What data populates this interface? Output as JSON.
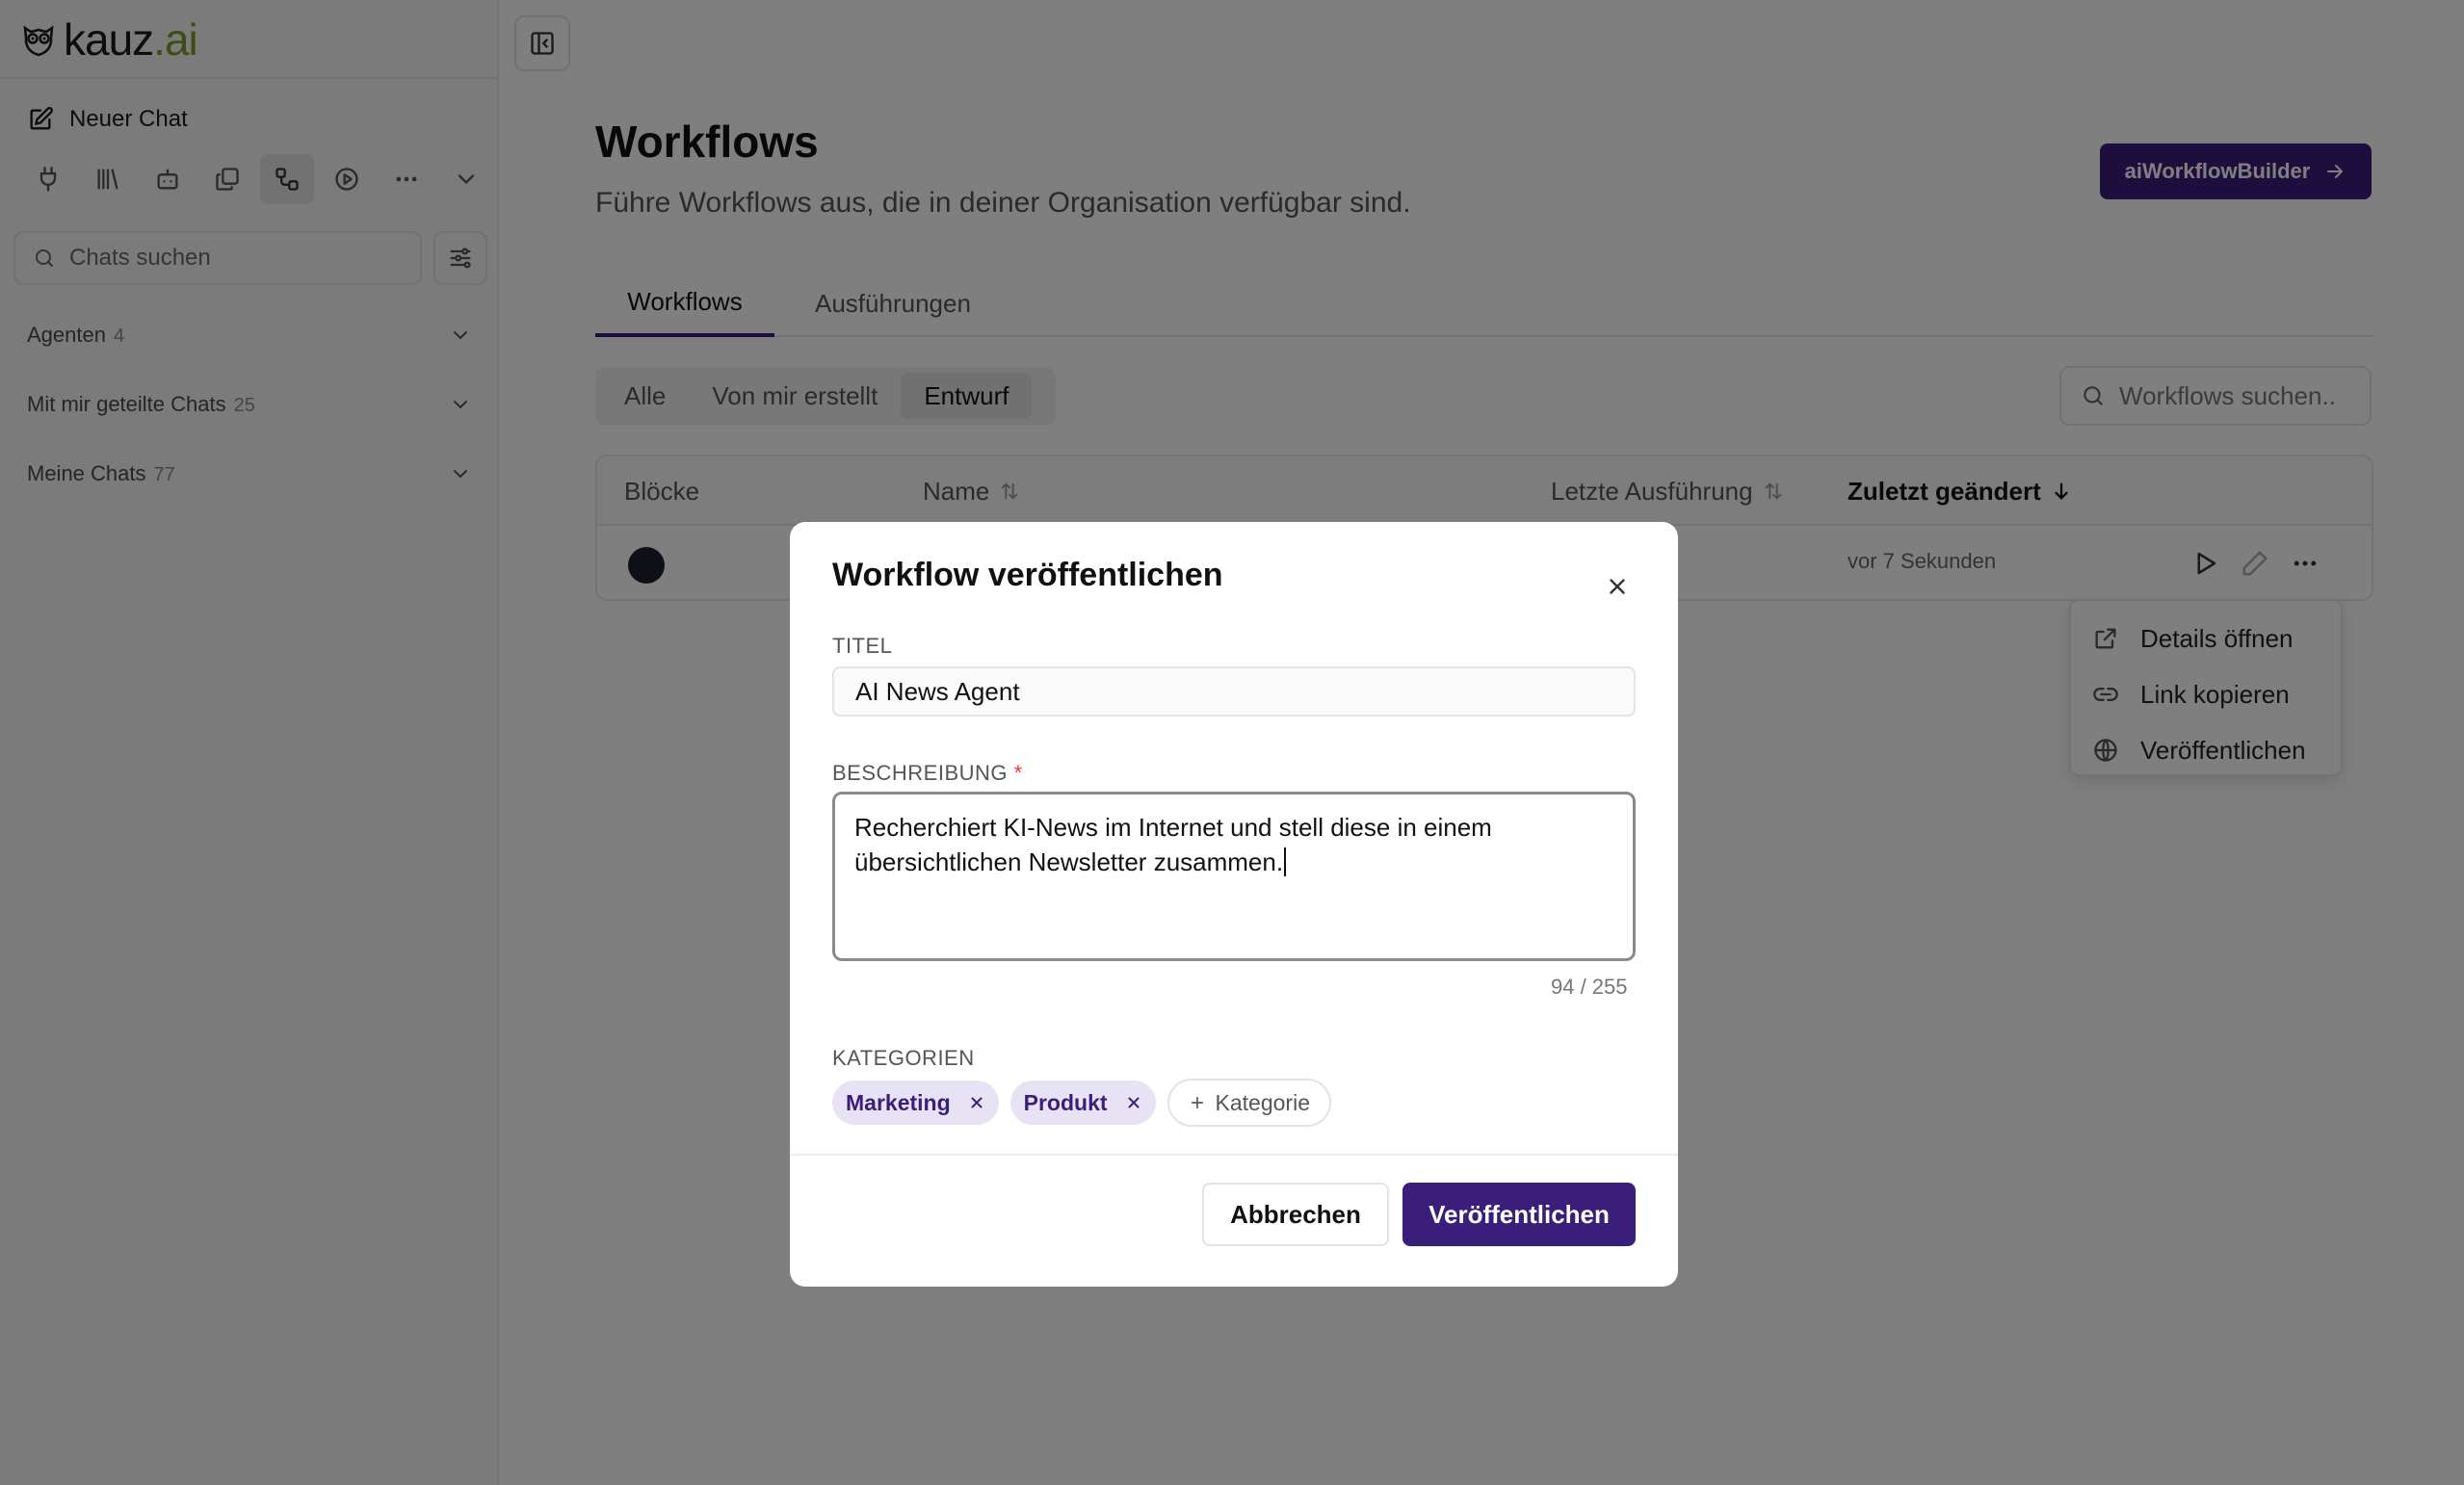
{
  "brand": {
    "name_main": "kauz",
    "name_suffix": ".ai",
    "accent": "#3b1d7a",
    "logo_green": "#7a9a2b"
  },
  "sidebar": {
    "new_chat": "Neuer Chat",
    "icons": [
      "plug-icon",
      "library-icon",
      "bot-icon",
      "files-icon",
      "workflow-icon",
      "play-circle-icon",
      "more-icon",
      "chevron-down-icon"
    ],
    "search_placeholder": "Chats suchen",
    "groups": [
      {
        "label": "Agenten",
        "count": "4"
      },
      {
        "label": "Mit mir geteilte Chats",
        "count": "25"
      },
      {
        "label": "Meine Chats",
        "count": "77"
      }
    ]
  },
  "main": {
    "title": "Workflows",
    "subtitle": "Führe Workflows aus, die in deiner Organisation verfügbar sind.",
    "builder_button": "aiWorkflowBuilder",
    "tabs": [
      {
        "label": "Workflows"
      },
      {
        "label": "Ausführungen"
      }
    ],
    "filters": [
      {
        "label": "Alle"
      },
      {
        "label": "Von mir erstellt"
      },
      {
        "label": "Entwurf"
      }
    ],
    "search_placeholder": "Workflows suchen..",
    "table": {
      "columns": [
        "Blöcke",
        "Name",
        "Letzte Ausführung",
        "Zuletzt geändert"
      ],
      "rows": [
        {
          "modified": "vor 7 Sekunden"
        }
      ]
    },
    "row_menu": [
      {
        "label": "Details öffnen",
        "icon": "external-link-icon"
      },
      {
        "label": "Link kopieren",
        "icon": "link-icon"
      },
      {
        "label": "Veröffentlichen",
        "icon": "globe-icon"
      }
    ]
  },
  "modal": {
    "title": "Workflow veröffentlichen",
    "title_label": "TITEL",
    "title_value": "AI News Agent",
    "description_label": "BESCHREIBUNG",
    "required_mark": "*",
    "description_value": "Recherchiert KI-News im Internet und stell diese in einem übersichtlichen Newsletter zusammen.",
    "char_count": "94 / 255",
    "categories_label": "KATEGORIEN",
    "categories": [
      "Marketing",
      "Produkt"
    ],
    "add_category": "Kategorie",
    "cancel": "Abbrechen",
    "publish": "Veröffentlichen"
  }
}
